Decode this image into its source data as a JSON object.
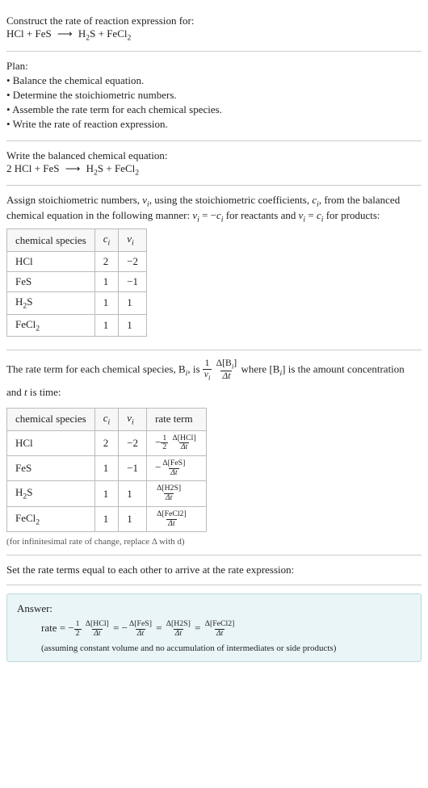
{
  "s1": {
    "line1": "Construct the rate of reaction expression for:",
    "eq_lhs": "HCl + FeS",
    "arrow": "⟶",
    "eq_rhs_a": "H",
    "eq_rhs_a_sub": "2",
    "eq_rhs_b": "S + FeCl",
    "eq_rhs_b_sub": "2"
  },
  "s2": {
    "heading": "Plan:",
    "items": [
      "• Balance the chemical equation.",
      "• Determine the stoichiometric numbers.",
      "• Assemble the rate term for each chemical species.",
      "• Write the rate of reaction expression."
    ]
  },
  "s3": {
    "line1": "Write the balanced chemical equation:",
    "eq_lhs": "2 HCl + FeS",
    "arrow": "⟶",
    "eq_rhs_a": "H",
    "eq_rhs_a_sub": "2",
    "eq_rhs_b": "S + FeCl",
    "eq_rhs_b_sub": "2"
  },
  "s4": {
    "p1a": "Assign stoichiometric numbers, ",
    "p1b": ", using the stoichiometric coefficients, ",
    "p1c": ", from the balanced chemical equation in the following manner: ",
    "p1d": " for reactants and ",
    "p1e": " for products:",
    "nu": "ν",
    "nu_i": "i",
    "c": "c",
    "c_i": "i",
    "eq1_l": "ν",
    "eq1_li": "i",
    "eq1_m": " = −",
    "eq1_r": "c",
    "eq1_ri": "i",
    "eq2_l": "ν",
    "eq2_li": "i",
    "eq2_m": " = ",
    "eq2_r": "c",
    "eq2_ri": "i",
    "headers": [
      "chemical species",
      "cᵢ",
      "νᵢ"
    ],
    "rows": [
      {
        "sp_a": "HCl",
        "sp_b": "",
        "c": "2",
        "v": "−2"
      },
      {
        "sp_a": "FeS",
        "sp_b": "",
        "c": "1",
        "v": "−1"
      },
      {
        "sp_a": "H",
        "sp_sub1": "2",
        "sp_b": "S",
        "c": "1",
        "v": "1"
      },
      {
        "sp_a": "FeCl",
        "sp_sub1": "2",
        "sp_b": "",
        "c": "1",
        "v": "1"
      }
    ]
  },
  "s5": {
    "p1a": "The rate term for each chemical species, B",
    "p1b": ", is ",
    "p1c": " where [B",
    "p1d": "] is the amount concentration and ",
    "p1e": " is time:",
    "i": "i",
    "t": "t",
    "f1n": "1",
    "f1d_a": "ν",
    "f1d_i": "i",
    "f2n_a": "Δ[B",
    "f2n_i": "i",
    "f2n_b": "]",
    "f2d": "Δt",
    "headers": [
      "chemical species",
      "cᵢ",
      "νᵢ",
      "rate term"
    ],
    "rows": [
      {
        "sp_a": "HCl",
        "c": "2",
        "v": "−2",
        "pre": "−",
        "cn": "1",
        "cd": "2",
        "num": "Δ[HCl]",
        "den": "Δt"
      },
      {
        "sp_a": "FeS",
        "c": "1",
        "v": "−1",
        "pre": "−",
        "num": "Δ[FeS]",
        "den": "Δt"
      },
      {
        "sp_a": "H",
        "sp_sub1": "2",
        "sp_b": "S",
        "c": "1",
        "v": "1",
        "num": "Δ[H2S]",
        "den": "Δt"
      },
      {
        "sp_a": "FeCl",
        "sp_sub1": "2",
        "c": "1",
        "v": "1",
        "num": "Δ[FeCl2]",
        "den": "Δt"
      }
    ],
    "note": "(for infinitesimal rate of change, replace Δ with d)"
  },
  "s6": {
    "line": "Set the rate terms equal to each other to arrive at the rate expression:"
  },
  "ans": {
    "label": "Answer:",
    "rate": "rate = ",
    "t1_pre": "−",
    "t1_cn": "1",
    "t1_cd": "2",
    "t1_num": "Δ[HCl]",
    "t1_den": "Δt",
    "eq": " = ",
    "t2_pre": "−",
    "t2_num": "Δ[FeS]",
    "t2_den": "Δt",
    "t3_num": "Δ[H2S]",
    "t3_den": "Δt",
    "t4_num": "Δ[FeCl2]",
    "t4_den": "Δt",
    "note": "(assuming constant volume and no accumulation of intermediates or side products)"
  }
}
